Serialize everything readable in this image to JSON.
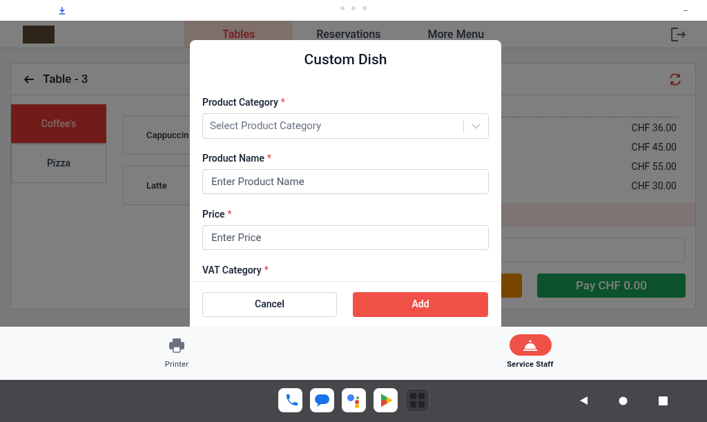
{
  "header": {
    "tabs": [
      {
        "label": "Tables",
        "selected": true
      },
      {
        "label": "Reservations",
        "selected": false
      },
      {
        "label": "More Menu",
        "selected": false
      }
    ]
  },
  "table_panel": {
    "title": "Table - 3",
    "categories": [
      {
        "label": "Coffee's",
        "selected": true
      },
      {
        "label": "Pizza",
        "selected": false
      }
    ],
    "products": [
      "Cappuccin",
      "Latte"
    ],
    "order_prices": [
      "CHF 36.00",
      "CHF 45.00",
      "CHF 55.00",
      "CHF 30.00"
    ],
    "pay_button": "Pay CHF 0.00"
  },
  "modal": {
    "title": "Custom Dish",
    "fields": [
      {
        "kind": "select",
        "label": "Product Category",
        "required_mark": "*",
        "placeholder": "Select Product Category"
      },
      {
        "kind": "text",
        "label": "Product Name",
        "required_mark": "*",
        "placeholder": "Enter Product Name"
      },
      {
        "kind": "text",
        "label": "Price",
        "required_mark": "*",
        "placeholder": "Enter Price"
      },
      {
        "kind": "label",
        "label": "VAT Category",
        "required_mark": "*"
      }
    ],
    "cancel": "Cancel",
    "add": "Add"
  },
  "bottom_nav": [
    {
      "label": "Printer",
      "kind": "printer",
      "selected": false
    },
    {
      "label": "Service Staff",
      "kind": "bell",
      "selected": true
    }
  ]
}
